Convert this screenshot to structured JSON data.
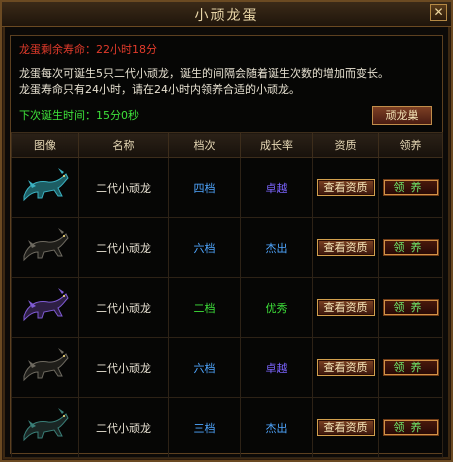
{
  "window": {
    "title": "小顽龙蛋"
  },
  "info": {
    "life_label": "龙蛋剩余寿命：22小时18分",
    "desc_line1": "龙蛋每次可诞生5只二代小顽龙，诞生的间隔会随着诞生次数的增加而变长。",
    "desc_line2": "龙蛋寿命只有24小时，请在24小时内领养合适的小顽龙。",
    "next_birth": "下次诞生时间：15分0秒"
  },
  "buttons": {
    "nest": "顽龙巢",
    "view": "查看资质",
    "claim": "领养"
  },
  "table": {
    "headers": [
      "图像",
      "名称",
      "档次",
      "成长率",
      "资质",
      "领养"
    ],
    "rows": [
      {
        "name": "二代小顽龙",
        "grade": "四档",
        "grade_color": "#4fa6ff",
        "rate": "卓越",
        "rate_color": "#7b64ff",
        "dragon": "teal-dragon-icon",
        "body": "#1d5d63",
        "accent": "#3bb2c2"
      },
      {
        "name": "二代小顽龙",
        "grade": "六档",
        "grade_color": "#4fa6ff",
        "rate": "杰出",
        "rate_color": "#4fa6ff",
        "dragon": "dark-dragon-icon",
        "body": "#1f1e1a",
        "accent": "#6e6a60"
      },
      {
        "name": "二代小顽龙",
        "grade": "二档",
        "grade_color": "#3ee23a",
        "rate": "优秀",
        "rate_color": "#3ee23a",
        "dragon": "purple-dragon-icon",
        "body": "#2e1f44",
        "accent": "#7f5bd4"
      },
      {
        "name": "二代小顽龙",
        "grade": "六档",
        "grade_color": "#4fa6ff",
        "rate": "卓越",
        "rate_color": "#7b64ff",
        "dragon": "dark-dragon-icon",
        "body": "#1f1e1a",
        "accent": "#6e6a60"
      },
      {
        "name": "二代小顽龙",
        "grade": "三档",
        "grade_color": "#4fa6ff",
        "rate": "杰出",
        "rate_color": "#4fa6ff",
        "dragon": "dark-teal-dragon-icon",
        "body": "#1a2624",
        "accent": "#3a7f78"
      }
    ]
  }
}
